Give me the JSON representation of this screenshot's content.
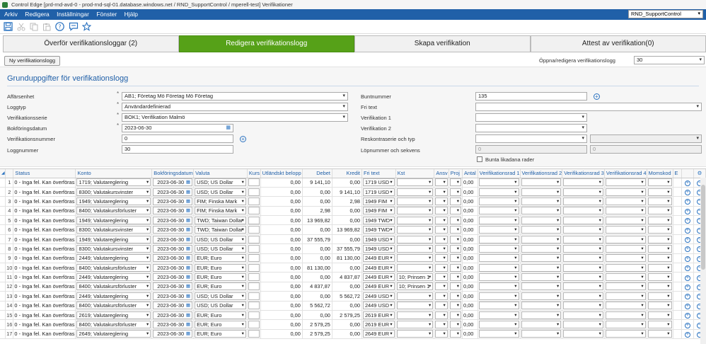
{
  "window": {
    "title": "Control Edge [prd-rnd-avd-0 - prod-rnd-sql-01.database.windows.net / RND_SupportControl / mperell-test] Verifikationer"
  },
  "menu": {
    "items": [
      "Arkiv",
      "Redigera",
      "Inställningar",
      "Fönster",
      "Hjälp"
    ],
    "database": "RND_SupportControl"
  },
  "toolbar": {
    "icons": [
      "save-icon",
      "cut-icon",
      "copy-icon",
      "paste-icon",
      "help-icon",
      "chat-icon",
      "star-icon"
    ]
  },
  "tabs": [
    {
      "label": "Överför verifikationsloggar (2)",
      "active": false
    },
    {
      "label": "Redigera verifikationslogg",
      "active": true
    },
    {
      "label": "Skapa verifikation",
      "active": false
    },
    {
      "label": "Attest av verifikation(0)",
      "active": false
    }
  ],
  "subbar": {
    "new_button": "Ny verifikationslogg",
    "open_label": "Öppna/redigera verifikationslogg",
    "open_value": "30"
  },
  "form": {
    "title": "Grunduppgifter för verifikationslogg",
    "affarsenhet": {
      "label": "Affärsenhet",
      "value": "AB1; Företag Mö Företag Mö Företag"
    },
    "loggtyp": {
      "label": "Loggtyp",
      "value": "Användardefinierad"
    },
    "verifikationsserie": {
      "label": "Verifikationsserie",
      "value": "BOK1; Verifikation Malmö"
    },
    "bokforingsdatum": {
      "label": "Bokföringsdatum",
      "value": "2023-06-30"
    },
    "verifikationsnummer": {
      "label": "Verifikationsnummer",
      "value": "0"
    },
    "loggnummer": {
      "label": "Loggnummer",
      "value": "30"
    },
    "buntnummer": {
      "label": "Buntnummer",
      "value": "135"
    },
    "fritext": {
      "label": "Fri text",
      "value": ""
    },
    "verifikation1": {
      "label": "Verifikation 1",
      "value": ""
    },
    "verifikation2": {
      "label": "Verifikation 2",
      "value": ""
    },
    "reskontra": {
      "label": "Reskontraserie och typ",
      "value": ""
    },
    "lopnummer": {
      "label": "Löpnummer och sekvens",
      "value1": "0",
      "value2": "0"
    },
    "bunta": {
      "label": "Bunta likadana rader",
      "checked": false
    }
  },
  "grid": {
    "columns": [
      "Status",
      "Konto",
      "Bokföringsdatum",
      "Valuta",
      "Kurs",
      "Utländskt belopp",
      "Debet",
      "Kredit",
      "Fri text",
      "Kst",
      "Ansv",
      "Proj",
      "Antal",
      "Verifikationsrad 1",
      "Verifikationsrad 2",
      "Verifikationsrad 3",
      "Verifikationsrad 4",
      "Momskod",
      "E"
    ],
    "rows": [
      {
        "n": "1",
        "status": "0 - Inga fel. Kan överföras",
        "konto": "1719; Valutareglering",
        "datum": "2023-06-30",
        "valuta": "USD; US Dollar",
        "belopp": "0,00",
        "debet": "9 141,10",
        "kredit": "0,00",
        "fritext": "1719 USD",
        "kst": "",
        "antal": "0,00"
      },
      {
        "n": "2",
        "status": "0 - Inga fel. Kan överföras",
        "konto": "8300; Valutakursvinster",
        "datum": "2023-06-30",
        "valuta": "USD; US Dollar",
        "belopp": "0,00",
        "debet": "0,00",
        "kredit": "9 141,10",
        "fritext": "1719 USD",
        "kst": "",
        "antal": "0,00"
      },
      {
        "n": "3",
        "status": "0 - Inga fel. Kan överföras",
        "konto": "1949; Valutareglering",
        "datum": "2023-06-30",
        "valuta": "FIM; Finska Mark",
        "belopp": "0,00",
        "debet": "0,00",
        "kredit": "2,98",
        "fritext": "1949 FIM",
        "kst": "",
        "antal": "0,00"
      },
      {
        "n": "4",
        "status": "0 - Inga fel. Kan överföras",
        "konto": "8400; Valutakursförluster",
        "datum": "2023-06-30",
        "valuta": "FIM; Finska Mark",
        "belopp": "0,00",
        "debet": "2,98",
        "kredit": "0,00",
        "fritext": "1949 FIM",
        "kst": "",
        "antal": "0,00"
      },
      {
        "n": "5",
        "status": "0 - Inga fel. Kan överföras",
        "konto": "1949; Valutareglering",
        "datum": "2023-06-30",
        "valuta": "TWD; Taiwan Dollar",
        "belopp": "0,00",
        "debet": "13 969,82",
        "kredit": "0,00",
        "fritext": "1949 TWD",
        "kst": "",
        "antal": "0,00"
      },
      {
        "n": "6",
        "status": "0 - Inga fel. Kan överföras",
        "konto": "8300; Valutakursvinster",
        "datum": "2023-06-30",
        "valuta": "TWD; Taiwan Dollar",
        "belopp": "0,00",
        "debet": "0,00",
        "kredit": "13 969,82",
        "fritext": "1949 TWD",
        "kst": "",
        "antal": "0,00"
      },
      {
        "n": "7",
        "status": "0 - Inga fel. Kan överföras",
        "konto": "1949; Valutareglering",
        "datum": "2023-06-30",
        "valuta": "USD; US Dollar",
        "belopp": "0,00",
        "debet": "37 555,79",
        "kredit": "0,00",
        "fritext": "1949 USD",
        "kst": "",
        "antal": "0,00"
      },
      {
        "n": "8",
        "status": "0 - Inga fel. Kan överföras",
        "konto": "8300; Valutakursvinster",
        "datum": "2023-06-30",
        "valuta": "USD; US Dollar",
        "belopp": "0,00",
        "debet": "0,00",
        "kredit": "37 555,79",
        "fritext": "1949 USD",
        "kst": "",
        "antal": "0,00"
      },
      {
        "n": "9",
        "status": "0 - Inga fel. Kan överföras",
        "konto": "2449; Valutareglering",
        "datum": "2023-06-30",
        "valuta": "EUR; Euro",
        "belopp": "0,00",
        "debet": "0,00",
        "kredit": "81 130,00",
        "fritext": "2449 EUR",
        "kst": "",
        "antal": "0,00"
      },
      {
        "n": "10",
        "status": "0 - Inga fel. Kan överföras",
        "konto": "8400; Valutakursförluster",
        "datum": "2023-06-30",
        "valuta": "EUR; Euro",
        "belopp": "0,00",
        "debet": "81 130,00",
        "kredit": "0,00",
        "fritext": "2449 EUR",
        "kst": "",
        "antal": "0,00"
      },
      {
        "n": "11",
        "status": "0 - Inga fel. Kan överföras",
        "konto": "2449; Valutareglering",
        "datum": "2023-06-30",
        "valuta": "EUR; Euro",
        "belopp": "0,00",
        "debet": "0,00",
        "kredit": "4 837,87",
        "fritext": "2449 EUR",
        "kst": "10; Prinsen 1",
        "antal": "0,00"
      },
      {
        "n": "12",
        "status": "0 - Inga fel. Kan överföras",
        "konto": "8400; Valutakursförluster",
        "datum": "2023-06-30",
        "valuta": "EUR; Euro",
        "belopp": "0,00",
        "debet": "4 837,87",
        "kredit": "0,00",
        "fritext": "2449 EUR",
        "kst": "10; Prinsen 1",
        "antal": "0,00"
      },
      {
        "n": "13",
        "status": "0 - Inga fel. Kan överföras",
        "konto": "2449; Valutareglering",
        "datum": "2023-06-30",
        "valuta": "USD; US Dollar",
        "belopp": "0,00",
        "debet": "0,00",
        "kredit": "5 562,72",
        "fritext": "2449 USD",
        "kst": "",
        "antal": "0,00"
      },
      {
        "n": "14",
        "status": "0 - Inga fel. Kan överföras",
        "konto": "8400; Valutakursförluster",
        "datum": "2023-06-30",
        "valuta": "USD; US Dollar",
        "belopp": "0,00",
        "debet": "5 562,72",
        "kredit": "0,00",
        "fritext": "2449 USD",
        "kst": "",
        "antal": "0,00"
      },
      {
        "n": "15",
        "status": "0 - Inga fel. Kan överföras",
        "konto": "2619; Valutareglering",
        "datum": "2023-06-30",
        "valuta": "EUR; Euro",
        "belopp": "0,00",
        "debet": "0,00",
        "kredit": "2 579,25",
        "fritext": "2619 EUR",
        "kst": "",
        "antal": "0,00"
      },
      {
        "n": "16",
        "status": "0 - Inga fel. Kan överföras",
        "konto": "8400; Valutakursförluster",
        "datum": "2023-06-30",
        "valuta": "EUR; Euro",
        "belopp": "0,00",
        "debet": "2 579,25",
        "kredit": "0,00",
        "fritext": "2619 EUR",
        "kst": "",
        "antal": "0,00"
      },
      {
        "n": "17",
        "status": "0 - Inga fel. Kan överföras",
        "konto": "2649; Valutareglering",
        "datum": "2023-06-30",
        "valuta": "EUR; Euro",
        "belopp": "0,00",
        "debet": "2 579,25",
        "kredit": "0,00",
        "fritext": "2649 EUR",
        "kst": "",
        "antal": "0,00"
      }
    ]
  },
  "colors": {
    "menubar": "#2060a8",
    "active_tab": "#56a118",
    "link_blue": "#1f5fa8"
  }
}
